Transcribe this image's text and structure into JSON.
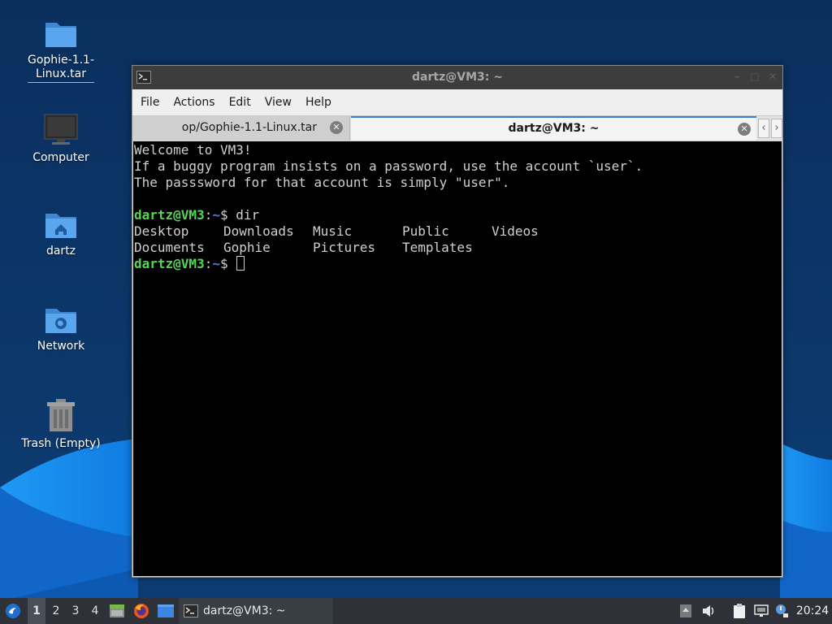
{
  "desktop": {
    "icons": [
      {
        "label": "Gophie-1.1-Linux.tar",
        "icon": "folder-icon"
      },
      {
        "label": "Computer",
        "icon": "monitor-icon"
      },
      {
        "label": "dartz",
        "icon": "home-folder-icon"
      },
      {
        "label": "Network",
        "icon": "network-folder-icon"
      },
      {
        "label": "Trash (Empty)",
        "icon": "trash-icon"
      }
    ],
    "icon_label_lines": {
      "gophie_line1": "Gophie-1.1-",
      "gophie_line2": "Linux.tar"
    }
  },
  "window": {
    "title": "dartz@VM3: ~",
    "menu": [
      "File",
      "Actions",
      "Edit",
      "View",
      "Help"
    ],
    "tabs": [
      {
        "label": "op/Gophie-1.1-Linux.tar",
        "active": false
      },
      {
        "label": "dartz@VM3: ~",
        "active": true
      }
    ]
  },
  "terminal": {
    "welcome": [
      "Welcome to VM3!",
      "If a buggy program insists on a password, use the account `user`.",
      "The passsword for that account is simply \"user\"."
    ],
    "prompt_user": "dartz@VM3",
    "prompt_sep": ":",
    "prompt_path": "~",
    "prompt_symbol": "$ ",
    "command": "dir",
    "dir_row1": [
      "Desktop",
      "Downloads",
      "Music",
      "Public",
      "Videos"
    ],
    "dir_row2": [
      "Documents",
      "Gophie",
      "Pictures",
      "Templates"
    ]
  },
  "taskbar": {
    "workspaces": [
      "1",
      "2",
      "3",
      "4"
    ],
    "active_workspace": "1",
    "task_label": "dartz@VM3: ~",
    "clock": "20:24"
  },
  "colors": {
    "wallpaper": "#0c3466",
    "wave_light": "#1a8cf0",
    "terminal_bg": "#000000",
    "prompt_user": "#54d654",
    "prompt_path": "#4f7fe0",
    "taskbar": "#2e3238"
  }
}
